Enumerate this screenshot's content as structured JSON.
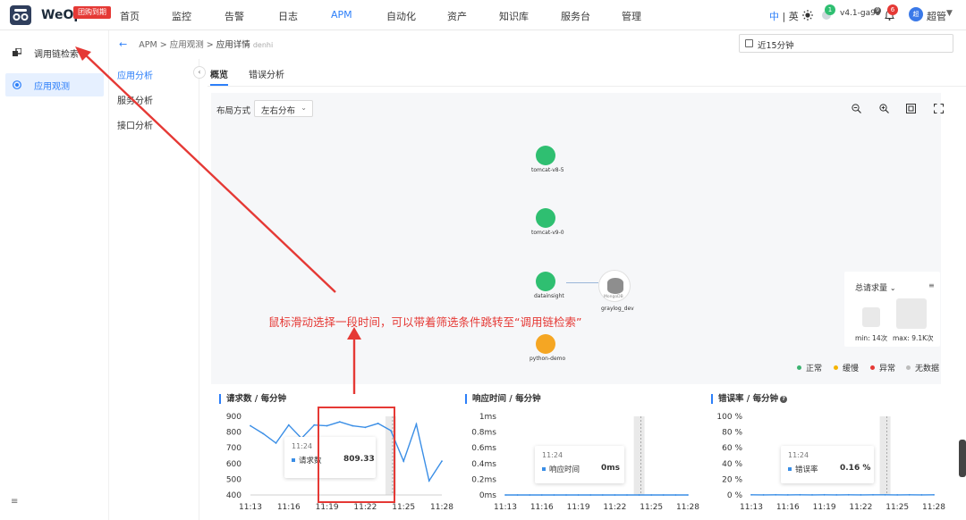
{
  "app": {
    "brand": "WeOps",
    "beta_badge": "团购到期"
  },
  "nav": [
    {
      "label": "首页"
    },
    {
      "label": "监控"
    },
    {
      "label": "告警"
    },
    {
      "label": "日志"
    },
    {
      "label": "APM"
    },
    {
      "label": "自动化"
    },
    {
      "label": "资产"
    },
    {
      "label": "知识库"
    },
    {
      "label": "服务台"
    },
    {
      "label": "管理"
    }
  ],
  "nav_active": "APM",
  "header": {
    "lang_zh": "中",
    "lang_sep": "|",
    "lang_en": "英",
    "notify_count": "1",
    "version": "v4.1-ga99",
    "version_mark": "9",
    "alert_count": "6",
    "avatar_text": "超",
    "user_name": "超管"
  },
  "sidebar": {
    "items": [
      {
        "label": "调用链检索",
        "icon": "trace-icon"
      },
      {
        "label": "应用观测",
        "icon": "observe-icon"
      }
    ],
    "active": "应用观测"
  },
  "breadcrumb": {
    "root": "APM",
    "parent": "应用观测",
    "current": "应用详情",
    "app": "denhi",
    "sep": ">"
  },
  "time_range": {
    "value": "近15分钟"
  },
  "subnav": {
    "items": [
      {
        "label": "应用分析"
      },
      {
        "label": "服务分析"
      },
      {
        "label": "接口分析"
      }
    ],
    "active": "应用分析"
  },
  "tabs": [
    {
      "label": "概览"
    },
    {
      "label": "错误分析"
    }
  ],
  "topology": {
    "layout_label": "布局方式",
    "layout_value": "左右分布",
    "nodes": [
      {
        "name": "tomcat-v8-5",
        "status": "normal"
      },
      {
        "name": "tomcat-v9-0",
        "status": "normal"
      },
      {
        "name": "datainsight",
        "status": "normal"
      },
      {
        "name": "python-demo",
        "status": "slow"
      },
      {
        "name": "graylog_dev",
        "status": "db",
        "sub": "MongoDB"
      }
    ],
    "legend_panel": {
      "title": "总请求量",
      "min": "min: 14次",
      "max": "max: 9.1K次"
    },
    "status_legend": [
      {
        "label": "正常",
        "color": "#3cb371"
      },
      {
        "label": "缓慢",
        "color": "#f5b400"
      },
      {
        "label": "异常",
        "color": "#e53935"
      },
      {
        "label": "无数据",
        "color": "#bdbdbd"
      }
    ],
    "colors": {
      "normal": "#2fbf71",
      "slow": "#f5a623"
    }
  },
  "annotation": {
    "text": "鼠标滑动选择一段时间，可以带着筛选条件跳转至“调用链检索”",
    "color": "#e53935"
  },
  "charts": {
    "requests": {
      "title": "请求数 / 每分钟",
      "tooltip": {
        "time": "11:24",
        "series": "请求数",
        "value": "809.33"
      }
    },
    "response": {
      "title": "响应时间 / 每分钟",
      "tooltip": {
        "time": "11:24",
        "series": "响应时间",
        "value": "0ms"
      }
    },
    "errors": {
      "title": "错误率 / 每分钟",
      "tooltip": {
        "time": "11:24",
        "series": "错误率",
        "value": "0.16 %"
      }
    }
  },
  "chart_data": [
    {
      "type": "line",
      "title": "请求数 / 每分钟",
      "x": [
        "11:13",
        "11:14",
        "11:15",
        "11:16",
        "11:17",
        "11:18",
        "11:19",
        "11:20",
        "11:21",
        "11:22",
        "11:23",
        "11:24",
        "11:25",
        "11:26",
        "11:27",
        "11:28"
      ],
      "x_ticks": [
        "11:13",
        "11:16",
        "11:19",
        "11:22",
        "11:25",
        "11:28"
      ],
      "y_ticks": [
        "900",
        "800",
        "700",
        "600",
        "500",
        "400"
      ],
      "ylim": [
        400,
        900
      ],
      "series": [
        {
          "name": "请求数",
          "values": [
            840,
            790,
            730,
            845,
            760,
            845,
            840,
            865,
            840,
            830,
            855,
            810,
            615,
            850,
            490,
            615
          ]
        }
      ],
      "color": "#3a8ee6"
    },
    {
      "type": "line",
      "title": "响应时间 / 每分钟",
      "x": [
        "11:13",
        "11:14",
        "11:15",
        "11:16",
        "11:17",
        "11:18",
        "11:19",
        "11:20",
        "11:21",
        "11:22",
        "11:23",
        "11:24",
        "11:25",
        "11:26",
        "11:27",
        "11:28"
      ],
      "x_ticks": [
        "11:13",
        "11:16",
        "11:19",
        "11:22",
        "11:25",
        "11:28"
      ],
      "y_ticks": [
        "1ms",
        "0.8ms",
        "0.6ms",
        "0.4ms",
        "0.2ms",
        "0ms"
      ],
      "ylim": [
        0,
        1
      ],
      "series": [
        {
          "name": "响应时间",
          "values": [
            0,
            0,
            0,
            0,
            0,
            0,
            0,
            0,
            0,
            0,
            0,
            0,
            0,
            0,
            0,
            0
          ]
        }
      ],
      "color": "#3a8ee6"
    },
    {
      "type": "line",
      "title": "错误率 / 每分钟",
      "x": [
        "11:13",
        "11:14",
        "11:15",
        "11:16",
        "11:17",
        "11:18",
        "11:19",
        "11:20",
        "11:21",
        "11:22",
        "11:23",
        "11:24",
        "11:25",
        "11:26",
        "11:27",
        "11:28"
      ],
      "x_ticks": [
        "11:13",
        "11:16",
        "11:19",
        "11:22",
        "11:25",
        "11:28"
      ],
      "y_ticks": [
        "100 %",
        "80 %",
        "60 %",
        "40 %",
        "20 %",
        "0 %"
      ],
      "ylim": [
        0,
        100
      ],
      "series": [
        {
          "name": "错误率",
          "values": [
            0.2,
            0.1,
            0.2,
            0.1,
            0.2,
            0.1,
            0.2,
            0.1,
            0.2,
            0.1,
            0.2,
            0.16,
            0.1,
            0.2,
            0.1,
            0.2
          ]
        }
      ],
      "color": "#3a8ee6"
    }
  ]
}
